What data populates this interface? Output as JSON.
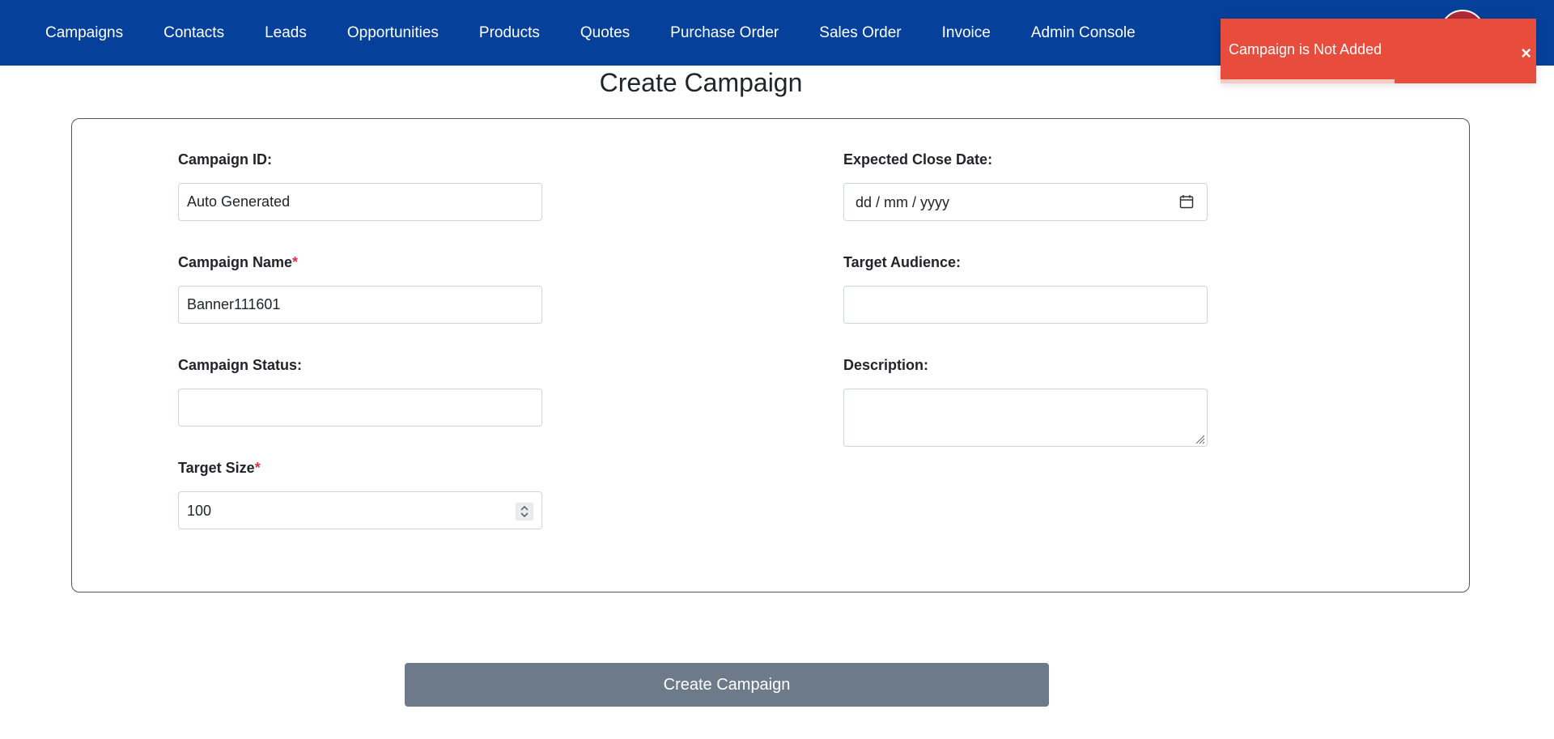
{
  "nav": {
    "items": [
      {
        "label": "Campaigns"
      },
      {
        "label": "Contacts"
      },
      {
        "label": "Leads"
      },
      {
        "label": "Opportunities"
      },
      {
        "label": "Products"
      },
      {
        "label": "Quotes"
      },
      {
        "label": "Purchase Order"
      },
      {
        "label": "Sales Order"
      },
      {
        "label": "Invoice"
      },
      {
        "label": "Admin Console"
      }
    ]
  },
  "toast": {
    "message": "Campaign is Not Added",
    "close_glyph": "×",
    "progress": 0.55,
    "color": "#e74c3c"
  },
  "page": {
    "title": "Create Campaign"
  },
  "form": {
    "campaign_id": {
      "label": "Campaign ID:",
      "value": "Auto Generated"
    },
    "campaign_name": {
      "label": "Campaign Name",
      "required_mark": "*",
      "value": "Banner111601"
    },
    "campaign_status": {
      "label": "Campaign Status:",
      "value": ""
    },
    "target_size": {
      "label": "Target Size",
      "required_mark": "*",
      "value": "100"
    },
    "expected_close_date": {
      "label": "Expected Close Date:",
      "placeholder": "dd / mm / yyyy"
    },
    "target_audience": {
      "label": "Target Audience:",
      "value": ""
    },
    "description": {
      "label": "Description:",
      "value": ""
    }
  },
  "submit": {
    "label": "Create Campaign"
  },
  "colors": {
    "navbar": "#05409b",
    "button": "#6c7a89",
    "required": "#dc3545"
  },
  "icons": {
    "date": "calendar-icon",
    "number": "spinner-icon",
    "close": "close-icon",
    "resize": "resize-grip-icon"
  }
}
